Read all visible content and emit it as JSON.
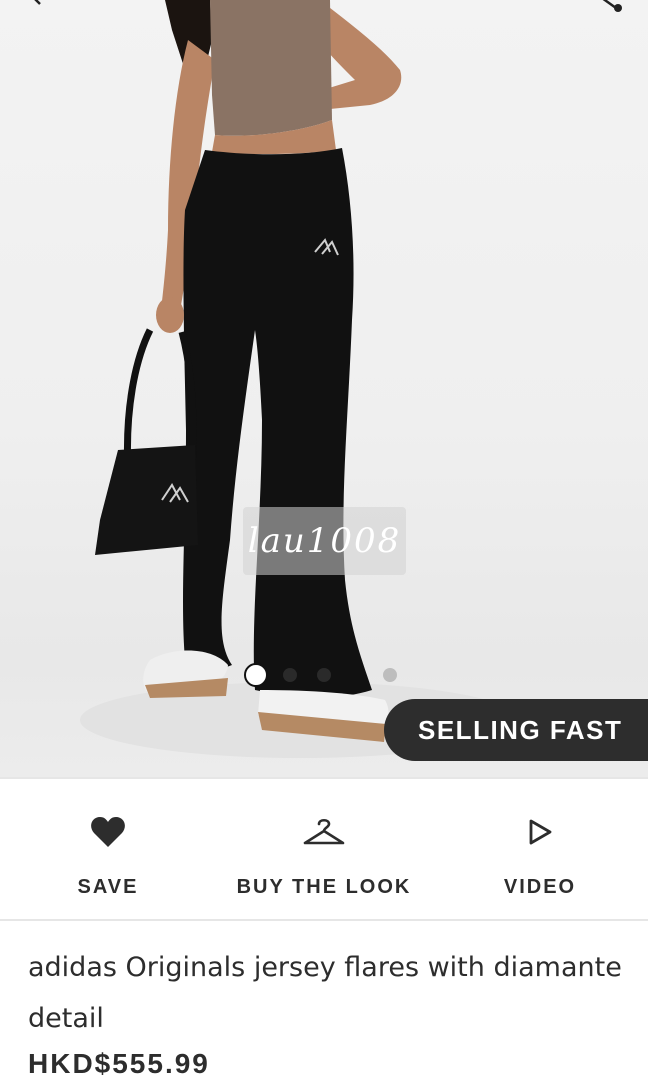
{
  "gallery": {
    "watermark": "lau1008",
    "dots": [
      "active",
      "inactive",
      "inactive",
      "disabled"
    ],
    "badge": "SELLING FAST"
  },
  "actions": [
    {
      "label": "SAVE",
      "icon": "heart-icon"
    },
    {
      "label": "BUY THE LOOK",
      "icon": "hanger-icon"
    },
    {
      "label": "VIDEO",
      "icon": "play-icon"
    }
  ],
  "product": {
    "title": "adidas Originals jersey flares with diamante detail",
    "price": "HKD$555.99"
  },
  "colors": {
    "badge_bg": "#2d2d2d",
    "text": "#2d2d2d",
    "divider": "#e6e6e6"
  }
}
